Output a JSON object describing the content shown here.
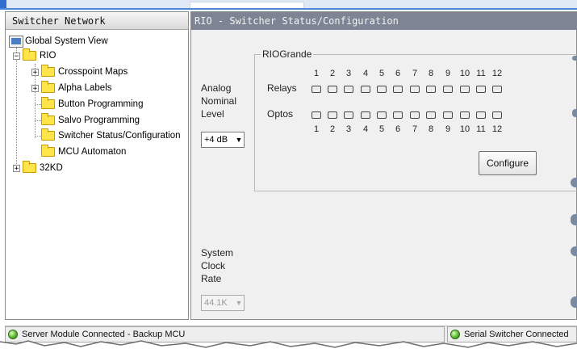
{
  "left_panel": {
    "title": "Switcher Network",
    "tree": {
      "root_label": "Global System View",
      "nodes": [
        {
          "label": "RIO",
          "expander": "−"
        },
        {
          "label": "Crosspoint Maps",
          "expander": "+"
        },
        {
          "label": "Alpha Labels",
          "expander": "+"
        },
        {
          "label": "Button Programming",
          "expander": ""
        },
        {
          "label": "Salvo Programming",
          "expander": ""
        },
        {
          "label": "Switcher Status/Configuration",
          "expander": ""
        },
        {
          "label": "MCU Automaton",
          "expander": ""
        },
        {
          "label": "32KD",
          "expander": "+"
        }
      ]
    }
  },
  "right_panel": {
    "title": "RIO - Switcher Status/Configuration",
    "analog": {
      "label_line1": "Analog",
      "label_line2": "Nominal",
      "label_line3": "Level",
      "select_value": "+4 dB"
    },
    "clock": {
      "label_line1": "System",
      "label_line2": "Clock",
      "label_line3": "Rate",
      "select_value": "44.1K"
    },
    "group": {
      "title": "RIOGrande",
      "relays_label": "Relays",
      "optos_label": "Optos",
      "top_numbers": [
        "1",
        "2",
        "3",
        "4",
        "5",
        "6",
        "7",
        "8",
        "9",
        "10",
        "11",
        "12"
      ],
      "bottom_numbers": [
        "1",
        "2",
        "3",
        "4",
        "5",
        "6",
        "7",
        "8",
        "9",
        "10",
        "11",
        "12"
      ],
      "configure_label": "Configure"
    }
  },
  "status_bar": {
    "left_text": "Server Module Connected - Backup MCU",
    "right_text": "Serial Switcher Connected"
  },
  "colors": {
    "header_dark": "#7d8594",
    "panel_bg": "#f0f0f0",
    "folder": "#ffe44a",
    "status_led": "#53b02a"
  }
}
